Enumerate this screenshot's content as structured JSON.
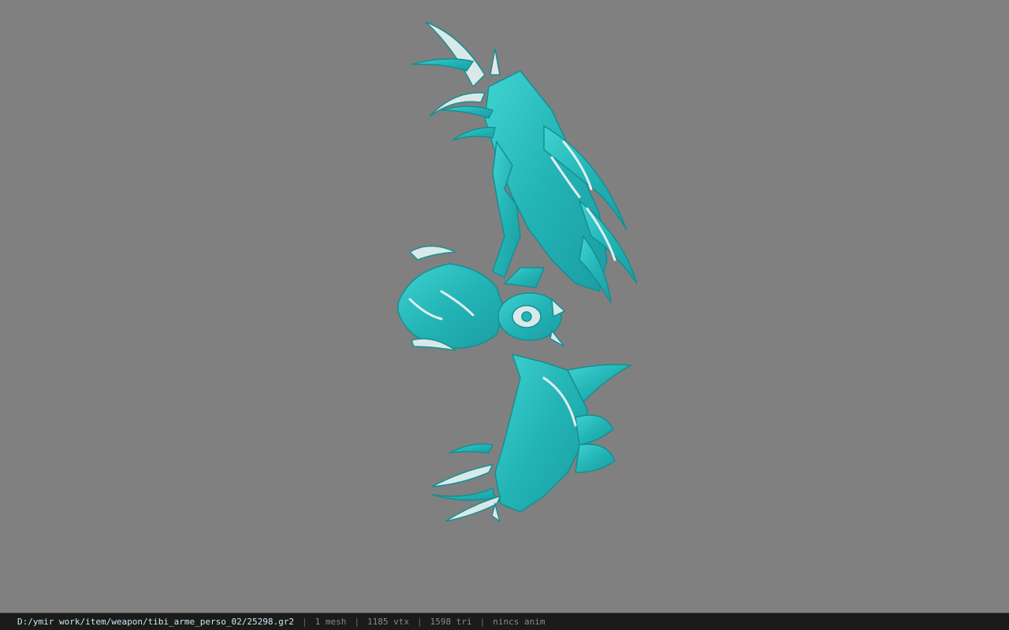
{
  "viewer": {
    "background_color": "#808080",
    "model_icon": "teal-bow-3d-model",
    "model_color": "#2bbfc0"
  },
  "status": {
    "path": "D:/ymir work/item/weapon/tibi_arme_perso_02/25298.gr2",
    "mesh": "1 mesh",
    "vtx": "1185 vtx",
    "tri": "1598 tri",
    "anim": "nincs anim",
    "separator": "|"
  }
}
